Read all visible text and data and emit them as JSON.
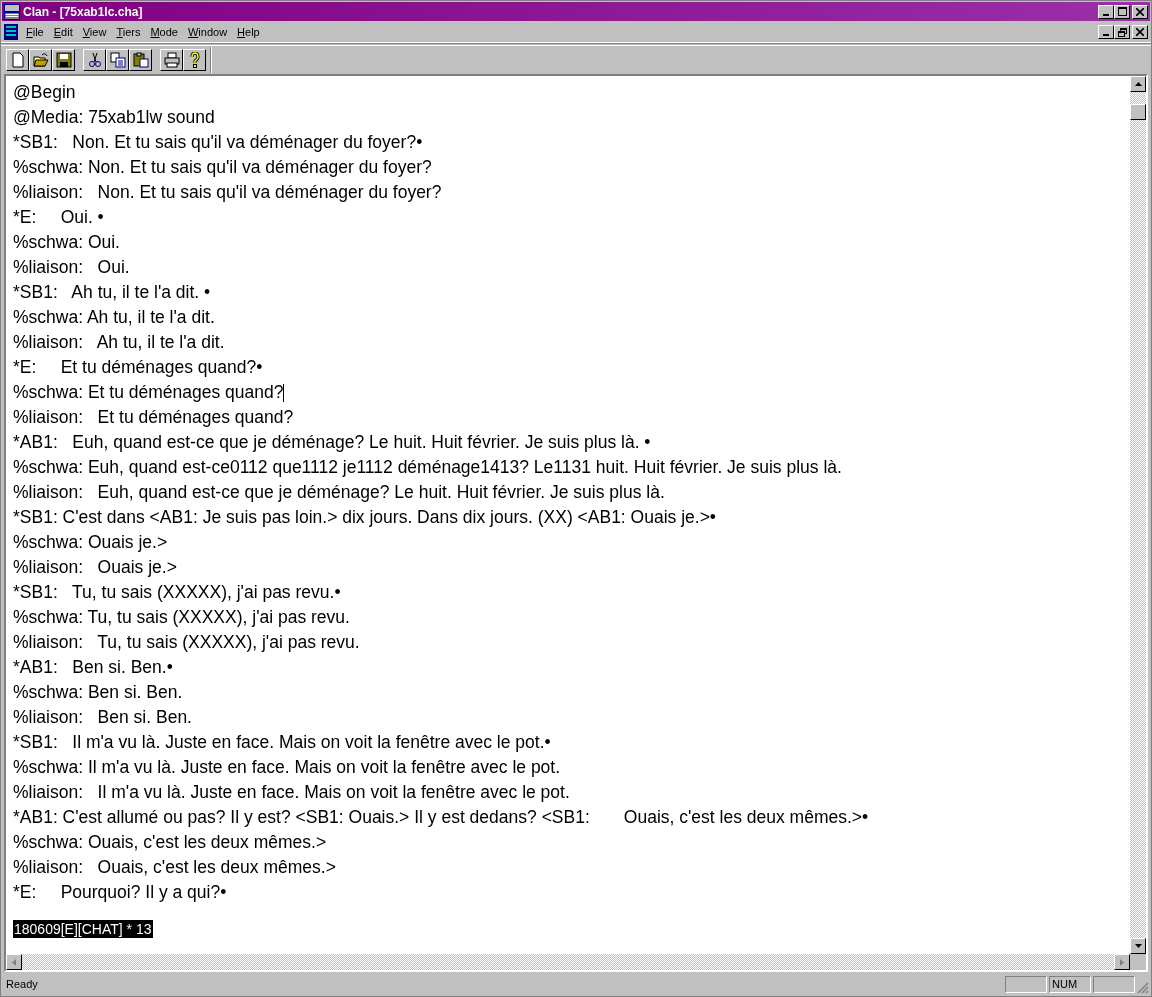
{
  "window": {
    "title": "Clan - [75xab1lc.cha]"
  },
  "menu": [
    "File",
    "Edit",
    "View",
    "Tiers",
    "Mode",
    "Window",
    "Help"
  ],
  "toolbar": [
    {
      "kind": "new"
    },
    {
      "kind": "open"
    },
    {
      "kind": "save"
    },
    {
      "kind": "sep"
    },
    {
      "kind": "cut"
    },
    {
      "kind": "copy"
    },
    {
      "kind": "paste"
    },
    {
      "kind": "sep"
    },
    {
      "kind": "print"
    },
    {
      "kind": "help"
    }
  ],
  "lines": [
    {
      "text": "@Begin"
    },
    {
      "text": "@Media: 75xab1lw sound"
    },
    {
      "text": "*SB1:   Non. Et tu sais qu'il va déménager du foyer?•"
    },
    {
      "text": "%schwa: Non. Et tu sais qu'il va déménager du foyer?"
    },
    {
      "text": "%liaison:   Non. Et tu sais qu'il va déménager du foyer?"
    },
    {
      "text": "*E:     Oui. •"
    },
    {
      "text": "%schwa: Oui."
    },
    {
      "text": "%liaison:   Oui."
    },
    {
      "text": "*SB1:   Ah tu, il te l'a dit. •"
    },
    {
      "text": "%schwa: Ah tu, il te l'a dit."
    },
    {
      "text": "%liaison:   Ah tu, il te l'a dit."
    },
    {
      "text": "*E:     Et tu déménages quand?•"
    },
    {
      "text": "%schwa: Et tu déménages quand?",
      "cursor": true
    },
    {
      "text": "%liaison:   Et tu déménages quand?"
    },
    {
      "text": "*AB1:   Euh, quand est-ce que je déménage? Le huit. Huit février. Je suis plus là. •"
    },
    {
      "text": "%schwa: Euh, quand est-ce0112 que1112 je1112 déménage1413? Le1131 huit. Huit février. Je suis plus là."
    },
    {
      "text": "%liaison:   Euh, quand est-ce que je déménage? Le huit. Huit février. Je suis plus là."
    },
    {
      "text": "*SB1: C'est dans <AB1: Je suis pas loin.> dix jours. Dans dix jours. (XX) <AB1: Ouais je.>•"
    },
    {
      "text": "%schwa: Ouais je.>"
    },
    {
      "text": "%liaison:   Ouais je.>"
    },
    {
      "text": "*SB1:   Tu, tu sais (XXXXX), j'ai pas revu.•"
    },
    {
      "text": "%schwa: Tu, tu sais (XXXXX), j'ai pas revu."
    },
    {
      "text": "%liaison:   Tu, tu sais (XXXXX), j'ai pas revu."
    },
    {
      "text": "*AB1:   Ben si. Ben.•"
    },
    {
      "text": "%schwa: Ben si. Ben."
    },
    {
      "text": "%liaison:   Ben si. Ben."
    },
    {
      "text": "*SB1:   Il m'a vu là. Juste en face. Mais on voit la fenêtre avec le pot.•"
    },
    {
      "text": "%schwa: Il m'a vu là. Juste en face. Mais on voit la fenêtre avec le pot."
    },
    {
      "text": "%liaison:   Il m'a vu là. Juste en face. Mais on voit la fenêtre avec le pot."
    },
    {
      "text": "*AB1: C'est allumé ou pas? Il y est? <SB1: Ouais.> Il y est dedans? <SB1:       Ouais, c'est les deux mêmes.>•"
    },
    {
      "text": "%schwa: Ouais, c'est les deux mêmes.>"
    },
    {
      "text": "%liaison:   Ouais, c'est les deux mêmes.>"
    },
    {
      "text": "*E:     Pourquoi? Il y a qui?•"
    }
  ],
  "mode_line": "180609[E][CHAT] * 13",
  "status_bar": {
    "message": "Ready",
    "num": "NUM"
  }
}
